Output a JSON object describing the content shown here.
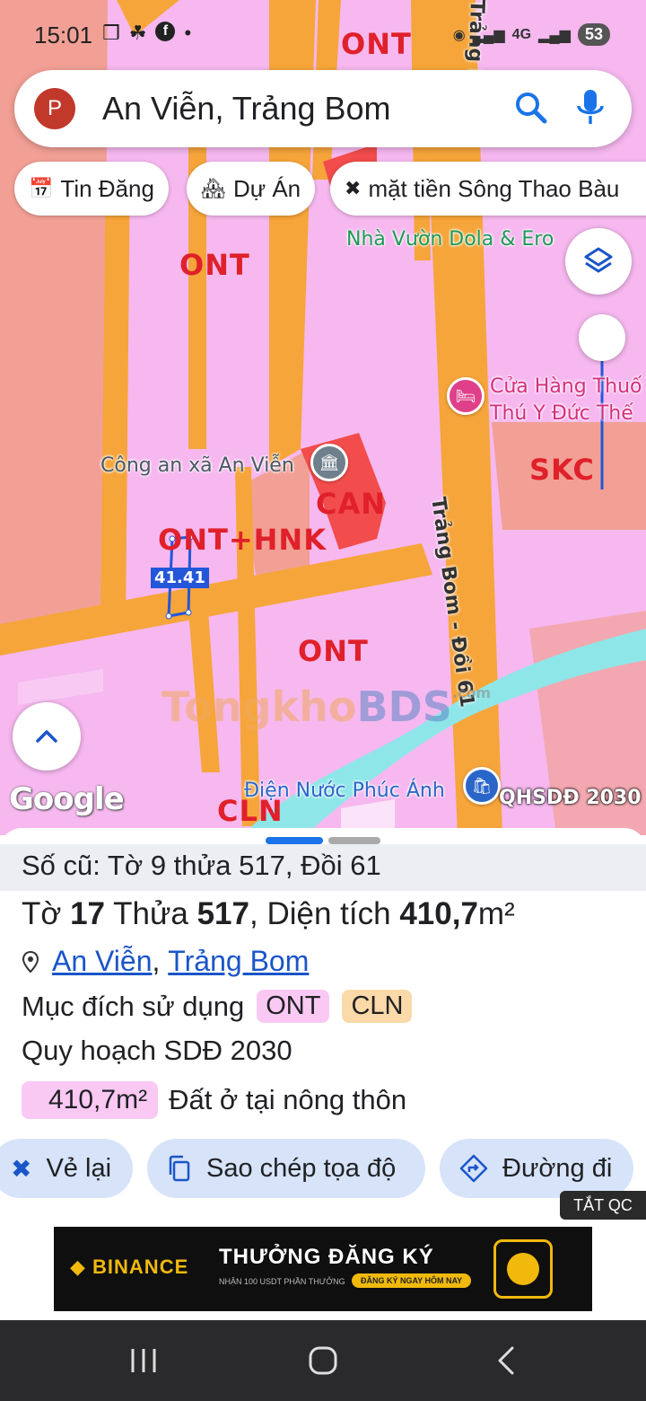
{
  "status_bar": {
    "time": "15:01",
    "left_icons": [
      "screenshot-icon",
      "leaf-icon",
      "facebook-icon",
      "dot-icon"
    ],
    "network": "4G",
    "battery": "53"
  },
  "search": {
    "avatar_letter": "P",
    "query": "An Viễn, Trảng Bom"
  },
  "chips": [
    {
      "icon": "calendar-icon",
      "label": "Tin Đăng"
    },
    {
      "icon": "building-icon",
      "label": "Dự Án"
    },
    {
      "icon": "tools-icon",
      "label": "mặt tiền Sông Thao Bàu"
    }
  ],
  "map": {
    "zone_labels": {
      "ont_top": "ONT",
      "ont_upper": "ONT",
      "ont_lower": "ONT",
      "ont_hnk": "ONT+HNK",
      "can": "CAN",
      "skc": "SKC",
      "cln": "CLN"
    },
    "pois": {
      "nha_vuon": "Nhà Vườn Dola & Ero",
      "cua_hang_1": "Cửa Hàng Thuố",
      "cua_hang_2": "Thú Y Đức Thế",
      "cong_an": "Công an xã An Viễn",
      "dien_nuoc": "Điện Nước Phúc Ánh"
    },
    "roads": {
      "main_road": "Trảng Bom - Đồi 61",
      "top_road": "Trảng Bo"
    },
    "parcel_badge": "41.41",
    "attribution": "Google",
    "plan_badge": "QHSDĐ 2030",
    "watermark_1": "Tongkho",
    "watermark_2": "BDS",
    "watermark_3": ".com"
  },
  "sheet": {
    "old_info": "Số cũ: Tờ 9 thửa 517, Đồi 61",
    "parcel": {
      "to_label": "Tờ",
      "to_value": "17",
      "thua_label": "Thửa",
      "thua_value": "517",
      "area_label": "Diện tích",
      "area_value": "410,7",
      "area_unit": "m²"
    },
    "location": {
      "commune": "An Viễn",
      "district": "Trảng Bom"
    },
    "purpose": {
      "label": "Mục đích sử dụng",
      "tags": [
        "ONT",
        "CLN"
      ],
      "tag_colors": [
        "#f9c9f4",
        "#fbd9a8"
      ]
    },
    "plan_title": "Quy hoạch SDĐ 2030",
    "plan_area": "410,7m²",
    "plan_desc": "Đất ở tại nông thôn",
    "actions": [
      {
        "icon": "redraw-icon",
        "label": "Vẻ lại"
      },
      {
        "icon": "copy-icon",
        "label": "Sao chép tọa độ"
      },
      {
        "icon": "directions-icon",
        "label": "Đường đi"
      }
    ]
  },
  "ad": {
    "close_label": "TẮT QC",
    "brand": "BINANCE",
    "headline": "THƯỞNG ĐĂNG KÝ",
    "sub": "NHẬN 100 USDT PHẦN THƯỞNG",
    "cta": "ĐĂNG KÝ NGAY HÔM NAY"
  },
  "colors": {
    "ont_pink": "#f6b8ef",
    "road_orange": "#f6a53a",
    "salmon": "#f2a095",
    "can_red": "#f24c4c",
    "river_cyan": "#8fe6e8",
    "accent_blue": "#1a55c9"
  }
}
